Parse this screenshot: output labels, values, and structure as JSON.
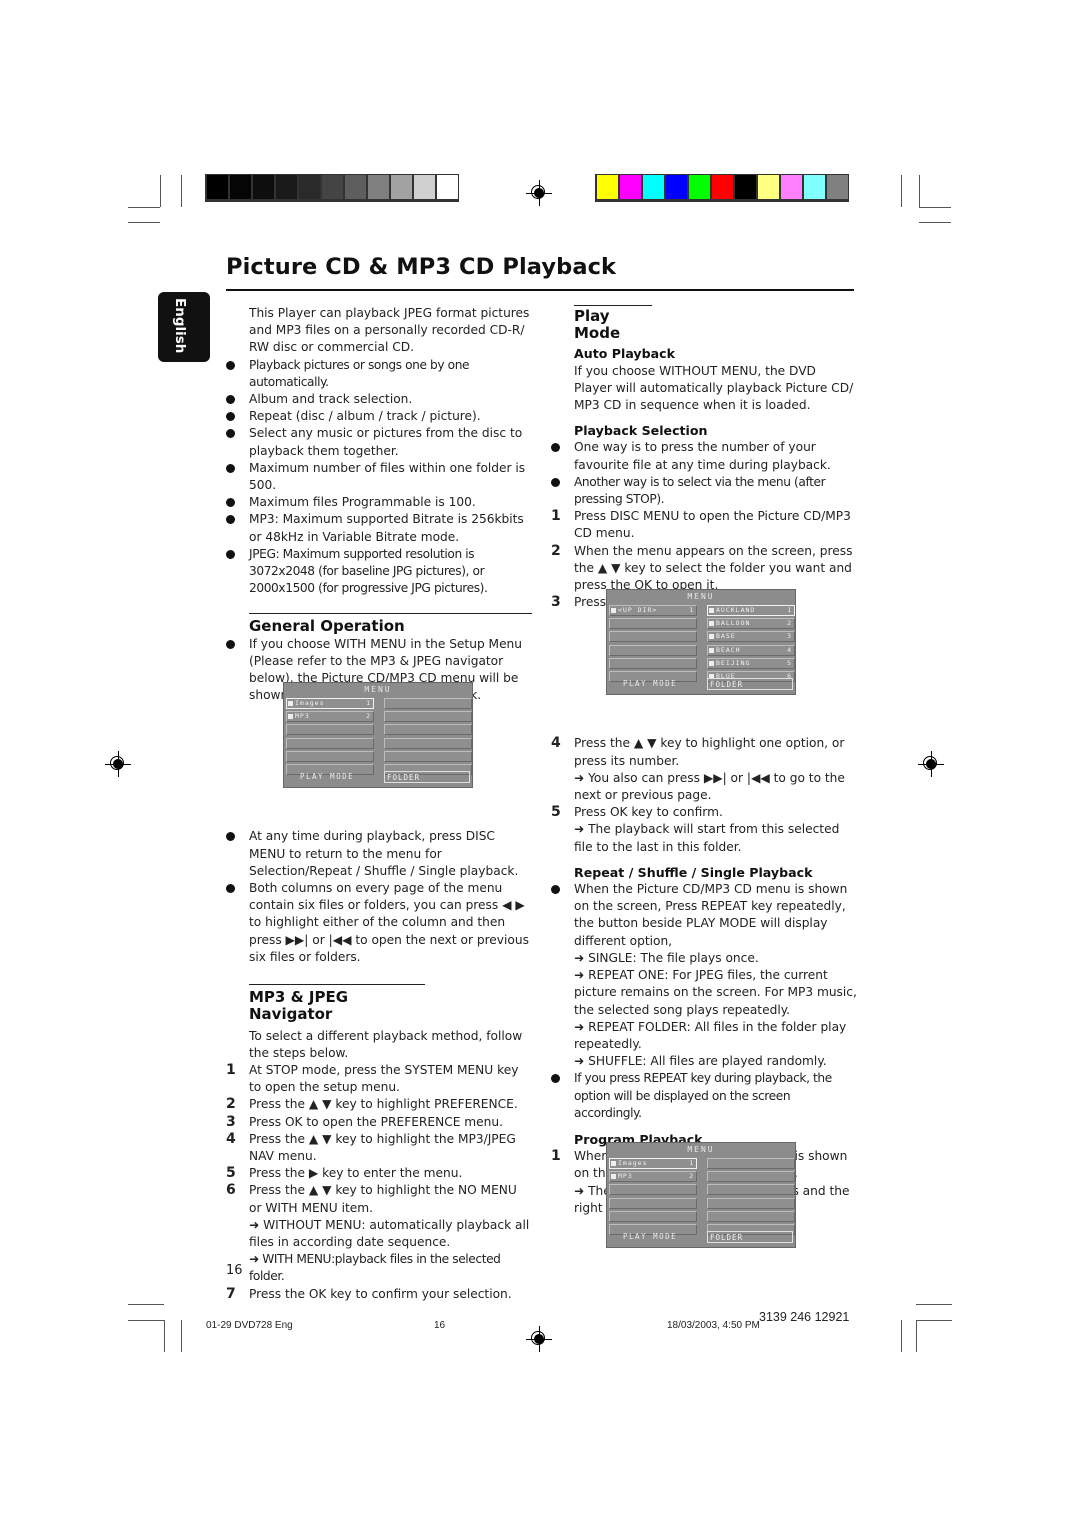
{
  "print_marks": {
    "gray_swatches": [
      "#000000",
      "#050505",
      "#0e0e0e",
      "#1a1a1a",
      "#2a2a2a",
      "#444444",
      "#5e5e5e",
      "#808080",
      "#a2a2a2",
      "#d0d0d0",
      "#ffffff"
    ],
    "color_swatches": [
      "#ffff00",
      "#ff00ff",
      "#00ffff",
      "#0000ff",
      "#00ff00",
      "#ff0000",
      "#000000",
      "#ffff80",
      "#ff80ff",
      "#80ffff",
      "#808080"
    ]
  },
  "page": {
    "title": "Picture CD & MP3 CD Playback",
    "language_tab": "English",
    "page_number": "16"
  },
  "left": {
    "intro": "This Player can playback JPEG format pictures and MP3 files on a personally recorded CD-R/ RW disc or commercial CD.",
    "features": [
      "Playback pictures or songs one by one automatically.",
      "Album and track selection.",
      "Repeat (disc / album / track / picture).",
      "Select any music or pictures from the disc to playback them together.",
      "Maximum number of files within one folder is 500.",
      "Maximum files Programmable is 100.",
      "MP3: Maximum supported Bitrate is 256kbits or 48kHz in Variable Bitrate mode.",
      "JPEG: Maximum supported resolution is 3072x2048 (for baseline JPG pictures), or 2000x1500 (for progressive JPG pictures)."
    ],
    "general_operation": {
      "heading": "General Operation",
      "bullet1": "If you choose WITH MENU in the Setup Menu (Please refer to the MP3 & JPEG navigator below), the Picture CD/MP3 CD menu will be shown on the screen before playback.",
      "bullet2": "At any time during playback, press DISC MENU to return to the menu for Selection/Repeat / Shuffle / Single playback.",
      "bullet3": "Both columns on every page of the menu contain six files or folders, you can press ◀ ▶ to highlight either of the column and then press ▶▶| or |◀◀ to open the next or previous six files or folders."
    },
    "navigator": {
      "heading": "MP3 & JPEG Navigator",
      "intro": "To select a different playback method, follow the steps below.",
      "steps": [
        {
          "n": "1",
          "text": "At STOP mode, press the SYSTEM MENU key to open the setup menu."
        },
        {
          "n": "2",
          "text": "Press the ▲ ▼ key to highlight PREFERENCE."
        },
        {
          "n": "3",
          "text": "Press OK to open the PREFERENCE menu."
        },
        {
          "n": "4",
          "text": "Press the ▲ ▼ key to highlight the MP3/JPEG NAV menu."
        },
        {
          "n": "5",
          "text": "Press the ▶ key to enter the menu."
        },
        {
          "n": "6",
          "text": "Press the ▲ ▼ key to highlight the NO MENU or WITH MENU item."
        },
        {
          "n": "7",
          "text": "Press the OK key to confirm your selection."
        }
      ],
      "note_without": "➜ WITHOUT MENU:  automatically playback all files in according date sequence.",
      "note_with": "➜ WITH MENU:playback files in the selected folder."
    }
  },
  "right": {
    "play_mode": {
      "heading": "Play Mode",
      "auto_heading": "Auto Playback",
      "auto_text": "If you choose WITHOUT MENU, the DVD Player will automatically playback Picture CD/ MP3 CD in sequence when it is loaded.",
      "selection_heading": "Playback Selection",
      "sel_bullet1": "One way is to press the number of your favourite file at any time during playback.",
      "sel_bullet2": "Another way is to select via the menu (after pressing STOP).",
      "steps": [
        {
          "n": "1",
          "text": "Press DISC MENU to open the Picture CD/MP3 CD menu."
        },
        {
          "n": "2",
          "text": "When the menu appears on the screen, press the ▲ ▼ key to select the folder you want and press the OK to open it."
        },
        {
          "n": "3",
          "text": "Press the ▶ to enter the file list."
        },
        {
          "n": "4",
          "text": "Press the ▲ ▼ key to highlight one option, or press its number."
        },
        {
          "n": "5",
          "text": "Press OK key to confirm."
        }
      ],
      "step4_note": "➜ You also can press ▶▶| or |◀◀ to go to the next or previous page.",
      "step5_note": "➜ The playback will start from this selected file to the last in this folder."
    },
    "repeat": {
      "heading": "Repeat / Shuffle / Single Playback",
      "bullet1": "When the Picture CD/MP3 CD menu is shown on the screen, Press REPEAT key repeatedly, the button beside PLAY MODE will display different option,",
      "notes": [
        "➜  SINGLE: The file plays once.",
        "➜  REPEAT ONE: For JPEG files, the current picture remains on the screen. For MP3 music, the selected song plays repeatedly.",
        "➜  REPEAT FOLDER: All files in the folder play repeatedly.",
        "➜  SHUFFLE: All files are played randomly."
      ],
      "bullet2": "If you press REPEAT key during playback, the option will be displayed on the screen accordingly."
    },
    "program": {
      "heading": "Program Playback",
      "step1": "When the Picture CD/MP3 CD menu is shown on the screen, Press DISC MENU key.",
      "step1_note": "➜ The left column is the original files and the right one is the programed files."
    }
  },
  "osd_menus": {
    "title": "MENU",
    "play_mode_label": "PLAY MODE",
    "folder_label": "FOLDER",
    "root_items": [
      {
        "label": "Images",
        "num": "1"
      },
      {
        "label": "MP3",
        "num": "2"
      }
    ],
    "updir_item": {
      "label": "<UP DIR>",
      "num": "1"
    },
    "file_items": [
      {
        "label": "AUCKLAND",
        "num": "1"
      },
      {
        "label": "BALLOON",
        "num": "2"
      },
      {
        "label": "BASE",
        "num": "3"
      },
      {
        "label": "BEACH",
        "num": "4"
      },
      {
        "label": "BEIJING",
        "num": "5"
      },
      {
        "label": "BLUE",
        "num": "6"
      }
    ]
  },
  "footer": {
    "file": "01-29 DVD728 Eng",
    "page": "16",
    "date": "18/03/2003, 4:50 PM",
    "code": "3139 246 12921"
  }
}
